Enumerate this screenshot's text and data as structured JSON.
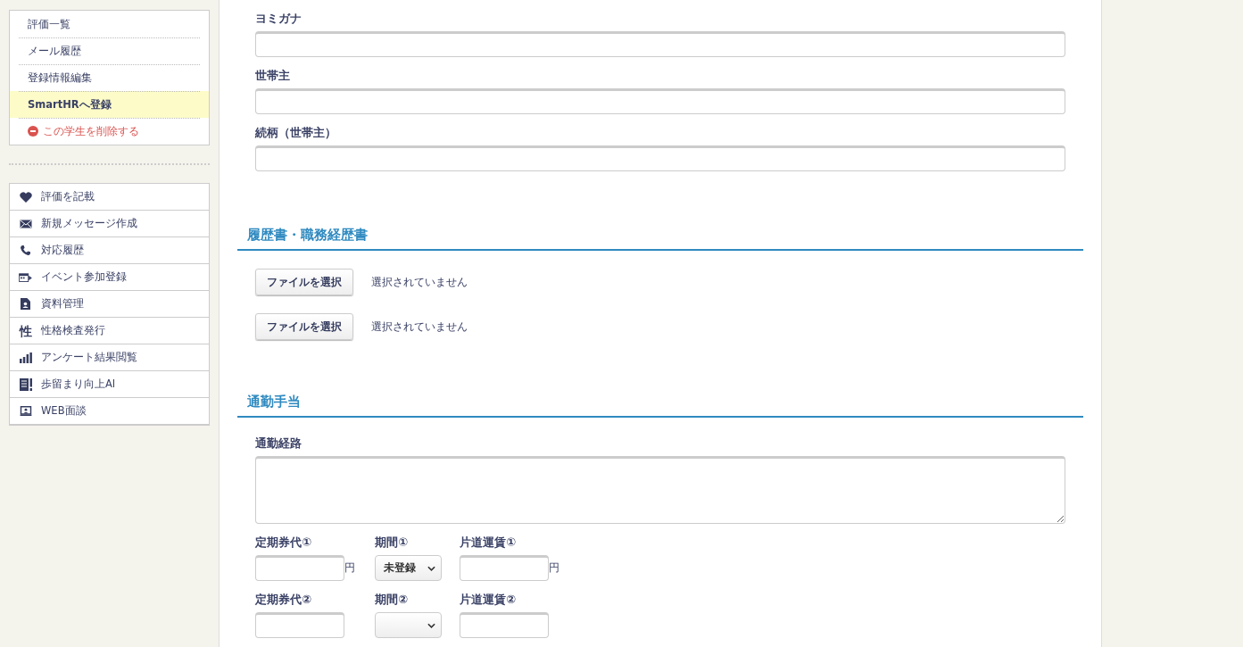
{
  "sidebar": {
    "menu": [
      {
        "label": "評価一覧",
        "selected": false,
        "kind": "link"
      },
      {
        "label": "メール履歴",
        "selected": false,
        "kind": "link"
      },
      {
        "label": "登録情報編集",
        "selected": false,
        "kind": "link"
      },
      {
        "label": "SmartHRへ登録",
        "selected": true,
        "kind": "link"
      },
      {
        "label": "この学生を削除する",
        "selected": false,
        "kind": "danger"
      }
    ],
    "actions": [
      {
        "label": "評価を記載",
        "kind": "heart"
      },
      {
        "label": "新規メッセージ作成",
        "kind": "mail"
      },
      {
        "label": "対応履歴",
        "kind": "phone"
      },
      {
        "label": "イベント参加登録",
        "kind": "event"
      },
      {
        "label": "資料管理",
        "kind": "doc"
      },
      {
        "label": "性格検査発行",
        "kind": "glyph",
        "glyph": "性"
      },
      {
        "label": "アンケート結果閲覧",
        "kind": "chart"
      },
      {
        "label": "歩留まり向上AI",
        "kind": "ai"
      },
      {
        "label": "WEB面談",
        "kind": "web"
      }
    ]
  },
  "form": {
    "fields": [
      {
        "label": "ヨミガナ"
      },
      {
        "label": "世帯主"
      },
      {
        "label": "続柄（世帯主）"
      }
    ],
    "sections": [
      {
        "title": "履歴書・職務経歴書",
        "kind": "files",
        "files": [
          {
            "button": "ファイルを選択",
            "status": "選択されていません"
          },
          {
            "button": "ファイルを選択",
            "status": "選択されていません"
          }
        ]
      },
      {
        "title": "通勤手当",
        "kind": "commute",
        "route_label": "通勤経路",
        "rows": [
          [
            {
              "kind": "amount",
              "label": "定期券代①",
              "unit": "円"
            },
            {
              "kind": "select",
              "label": "期間①",
              "value": "未登録"
            },
            {
              "kind": "amount",
              "label": "片道運賃①",
              "unit": "円"
            }
          ],
          [
            {
              "kind": "amount",
              "label": "定期券代②"
            },
            {
              "kind": "select",
              "label": "期間②"
            },
            {
              "kind": "amount",
              "label": "片道運賃②"
            }
          ]
        ]
      }
    ]
  }
}
